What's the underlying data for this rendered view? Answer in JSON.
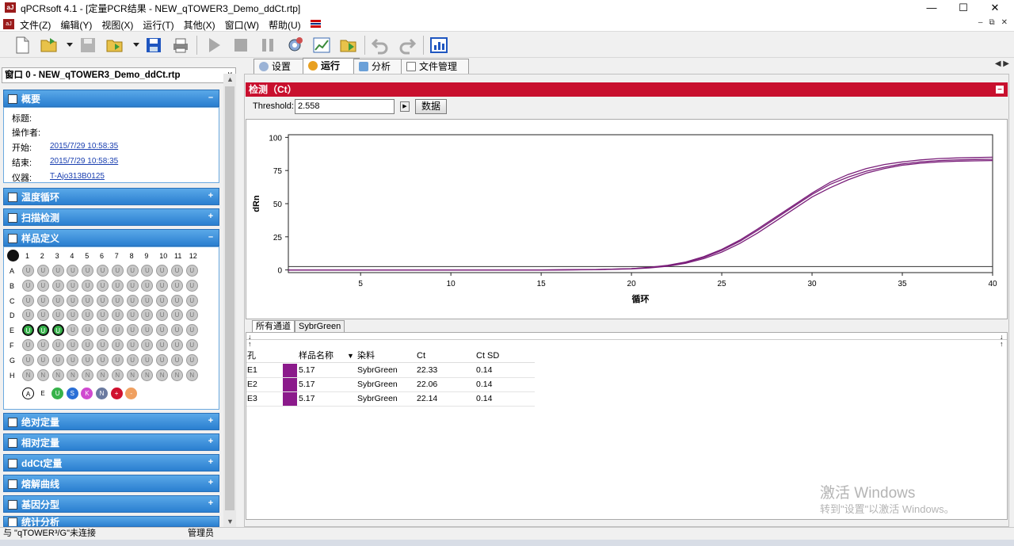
{
  "window": {
    "title": "qPCRsoft 4.1 - [定量PCR结果 - NEW_qTOWER3_Demo_ddCt.rtp]",
    "controls": {
      "minimize": "—",
      "maximize": "☐",
      "close": "✕"
    }
  },
  "menu": {
    "items": [
      "文件(Z)",
      "编辑(Y)",
      "视图(X)",
      "运行(T)",
      "其他(X)",
      "窗口(W)",
      "帮助(U)"
    ],
    "mdi_controls": [
      "–",
      "⧉",
      "✕"
    ]
  },
  "window_selector": {
    "value": "窗口 0 - NEW_qTOWER3_Demo_ddCt.rtp"
  },
  "sections": {
    "overview": "概要",
    "thermal": "温度循环",
    "scan": "扫描检测",
    "sample_def": "样品定义",
    "abs_quant": "绝对定量",
    "rel_quant": "相对定量",
    "ddct": "ddCt定量",
    "melt": "熔解曲线",
    "genotype": "基因分型",
    "extra": "统计分析"
  },
  "overview": {
    "labels": {
      "title": "标题:",
      "operator": "操作者:",
      "start": "开始:",
      "end": "结束:",
      "instrument": "仪器:"
    },
    "start": "2015/7/29 10:58:35",
    "end": "2015/7/29 10:58:35",
    "instrument": "T-Ajo313B0125"
  },
  "plate": {
    "columns": [
      "1",
      "2",
      "3",
      "4",
      "5",
      "6",
      "7",
      "8",
      "9",
      "10",
      "11",
      "12"
    ],
    "rows": [
      "A",
      "B",
      "C",
      "D",
      "E",
      "F",
      "G",
      "H"
    ],
    "legend": [
      "A",
      "E",
      "U",
      "S",
      "K",
      "N",
      "+",
      "-"
    ]
  },
  "tabs": [
    "设置",
    "运行",
    "分析",
    "文件管理"
  ],
  "detect": {
    "title": "检测（Ct）",
    "threshold_label": "Threshold:",
    "threshold_value": "2.558",
    "data_button": "数据"
  },
  "channel_tabs": [
    "所有通道",
    "SybrGreen"
  ],
  "table": {
    "headers": [
      "孔",
      "",
      "样品名称",
      "染料",
      "Ct",
      "Ct SD"
    ],
    "rows": [
      {
        "well": "E1",
        "sample": "5.17",
        "dye": "SybrGreen",
        "ct": "22.33",
        "ctsd": "0.14"
      },
      {
        "well": "E2",
        "sample": "5.17",
        "dye": "SybrGreen",
        "ct": "22.06",
        "ctsd": "0.14"
      },
      {
        "well": "E3",
        "sample": "5.17",
        "dye": "SybrGreen",
        "ct": "22.14",
        "ctsd": "0.14"
      }
    ]
  },
  "chart_data": {
    "type": "line",
    "title": "",
    "xlabel": "循环",
    "ylabel": "dRn",
    "xlim": [
      1,
      40
    ],
    "ylim": [
      -2,
      102
    ],
    "xticks": [
      5,
      10,
      15,
      20,
      25,
      30,
      35,
      40
    ],
    "yticks": [
      0,
      25,
      50,
      75,
      100
    ],
    "threshold": 2.558,
    "grid": false,
    "series": [
      {
        "color": "#7a1f7a",
        "x": [
          1,
          5,
          10,
          15,
          18,
          20,
          21,
          22,
          23,
          24,
          25,
          26,
          27,
          28,
          29,
          30,
          31,
          32,
          33,
          34,
          35,
          36,
          37,
          38,
          39,
          40
        ],
        "y": [
          0,
          0,
          0,
          0,
          0.2,
          0.8,
          1.5,
          2.8,
          5,
          8.5,
          13.5,
          20,
          28,
          37,
          46,
          55,
          62,
          68,
          73,
          76.5,
          79,
          80.5,
          81.5,
          82,
          82.3,
          82.5
        ]
      },
      {
        "color": "#7a1f7a",
        "x": [
          1,
          5,
          10,
          15,
          18,
          20,
          21,
          22,
          23,
          24,
          25,
          26,
          27,
          28,
          29,
          30,
          31,
          32,
          33,
          34,
          35,
          36,
          37,
          38,
          39,
          40
        ],
        "y": [
          0,
          0,
          0,
          0,
          0.3,
          1,
          1.8,
          3.2,
          5.6,
          9.4,
          14.8,
          21.6,
          30,
          39,
          48,
          57,
          64.5,
          70,
          74.5,
          77.5,
          80,
          81.5,
          82.5,
          83,
          83.3,
          83.5
        ]
      },
      {
        "color": "#7a1f7a",
        "x": [
          1,
          5,
          10,
          15,
          18,
          20,
          21,
          22,
          23,
          24,
          25,
          26,
          27,
          28,
          29,
          30,
          31,
          32,
          33,
          34,
          35,
          36,
          37,
          38,
          39,
          40
        ],
        "y": [
          0,
          0,
          0,
          0,
          0.3,
          1,
          2,
          3.5,
          6,
          10,
          15.5,
          22.5,
          31,
          40,
          49,
          58,
          66,
          72,
          76.5,
          79.5,
          81.5,
          83,
          84,
          84.5,
          84.8,
          85
        ]
      }
    ]
  },
  "watermark": {
    "line1": "激活 Windows",
    "line2": "转到\"设置\"以激活 Windows。"
  },
  "status": {
    "connection": "与 \"qTOWER³/G\"未连接",
    "user": "管理员"
  },
  "colors": {
    "accent_red": "#c8102e",
    "section_blue": "#2a7fd0",
    "curve_purple": "#7a1f7a",
    "selected_well": "#36b24a"
  }
}
